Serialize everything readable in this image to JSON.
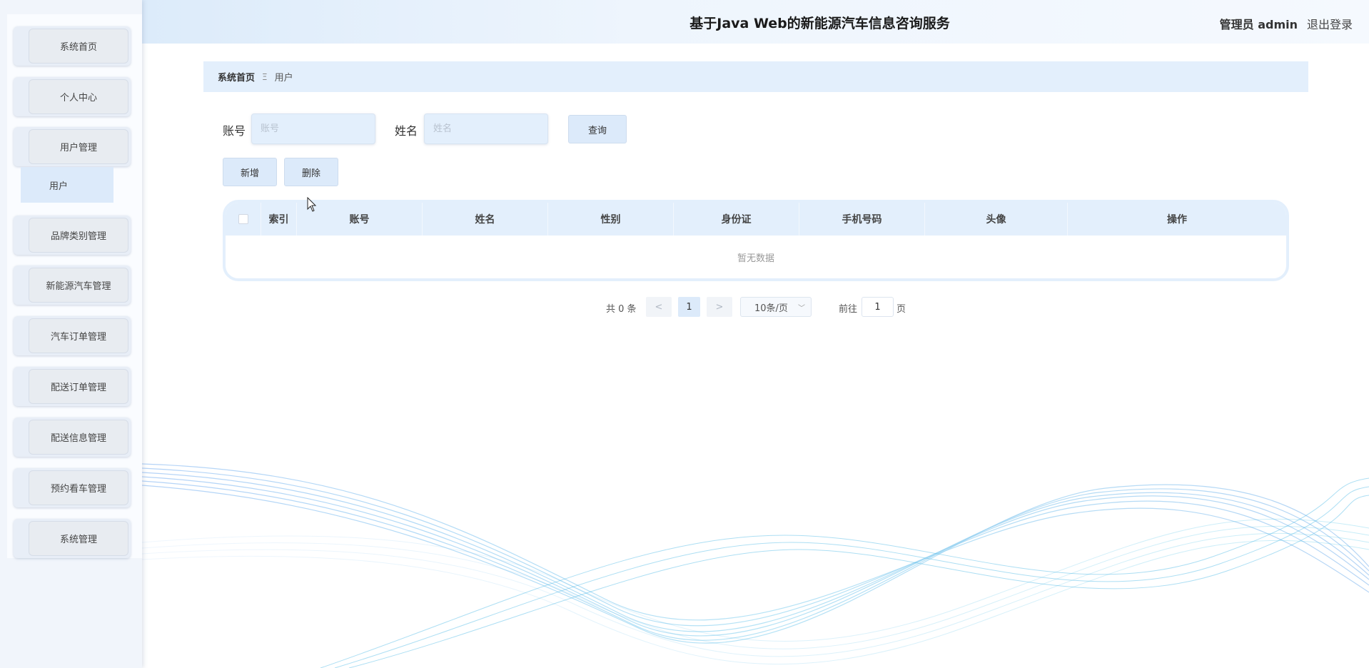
{
  "header": {
    "title": "基于Java Web的新能源汽车信息咨询服务",
    "user": "管理员 admin",
    "logout": "退出登录"
  },
  "sidebar": {
    "items": [
      {
        "label": "系统首页"
      },
      {
        "label": "个人中心"
      },
      {
        "label": "用户管理"
      },
      {
        "label": "品牌类别管理"
      },
      {
        "label": "新能源汽车管理"
      },
      {
        "label": "汽车订单管理"
      },
      {
        "label": "配送订单管理"
      },
      {
        "label": "配送信息管理"
      },
      {
        "label": "预约看车管理"
      },
      {
        "label": "系统管理"
      }
    ],
    "submenu": {
      "label": "用户"
    }
  },
  "breadcrumb": {
    "home": "系统首页",
    "separator": "Ξ",
    "current": "用户"
  },
  "search": {
    "account_label": "账号",
    "account_placeholder": "账号",
    "account_value": "",
    "name_label": "姓名",
    "name_placeholder": "姓名",
    "name_value": "",
    "query_button": "查询"
  },
  "actions": {
    "add": "新增",
    "delete": "删除"
  },
  "table": {
    "columns": [
      "索引",
      "账号",
      "姓名",
      "性别",
      "身份证",
      "手机号码",
      "头像",
      "操作"
    ],
    "rows": [],
    "empty_text": "暂无数据"
  },
  "pagination": {
    "total": "共 0 条",
    "prev": "<",
    "current_page": "1",
    "next": ">",
    "page_size": "10条/页",
    "goto_label": "前往",
    "goto_value": "1",
    "page_suffix": "页"
  },
  "colors": {
    "accent": "#e3effc",
    "button": "#dceafa",
    "sidebar": "#e8eef7"
  }
}
